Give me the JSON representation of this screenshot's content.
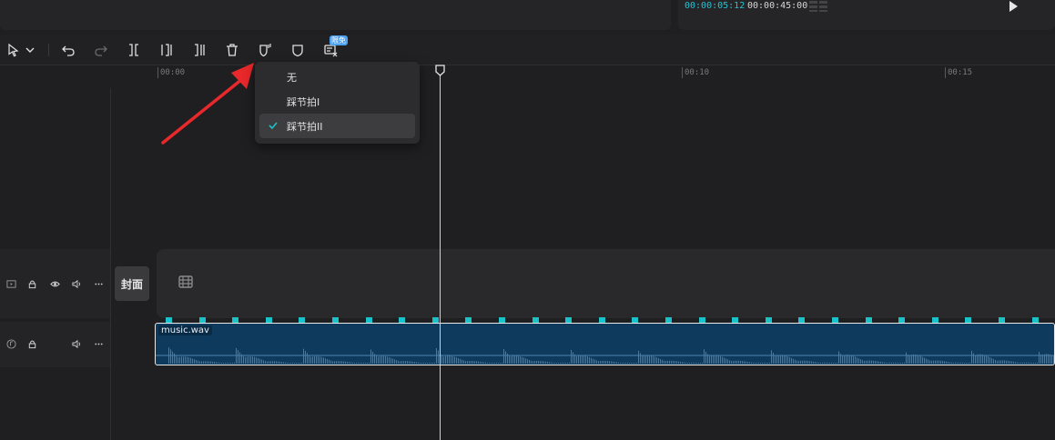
{
  "preview": {
    "current_time": "00:00:05:12",
    "total_time": "00:00:45:00"
  },
  "toolbar": {
    "badge": "限免",
    "tools": [
      {
        "name": "select-tool",
        "icon": "cursor-icon"
      },
      {
        "name": "undo",
        "icon": "undo-icon"
      },
      {
        "name": "redo",
        "icon": "redo-icon"
      },
      {
        "name": "split",
        "icon": "split-icon"
      },
      {
        "name": "delete-left",
        "icon": "trim-left-icon"
      },
      {
        "name": "delete-right",
        "icon": "trim-right-icon"
      },
      {
        "name": "delete",
        "icon": "trash-icon"
      },
      {
        "name": "auto-beat",
        "icon": "beat-shield-icon"
      },
      {
        "name": "marker",
        "icon": "shield-icon"
      },
      {
        "name": "subtitle",
        "icon": "subtitle-icon"
      }
    ]
  },
  "ruler": {
    "ticks": [
      "00:00",
      "00:10",
      "00:15"
    ]
  },
  "beat_menu": {
    "items": [
      {
        "label": "无",
        "selected": false
      },
      {
        "label": "踩节拍I",
        "selected": false
      },
      {
        "label": "踩节拍II",
        "selected": true
      }
    ]
  },
  "tracks": {
    "cover_label": "封面",
    "audio_clip_name": "music.wav"
  },
  "colors": {
    "accent": "#19c3c9",
    "timecode": "#22c3d6",
    "audio_clip": "#0e3a5e",
    "annotation_arrow": "#e8282b"
  }
}
